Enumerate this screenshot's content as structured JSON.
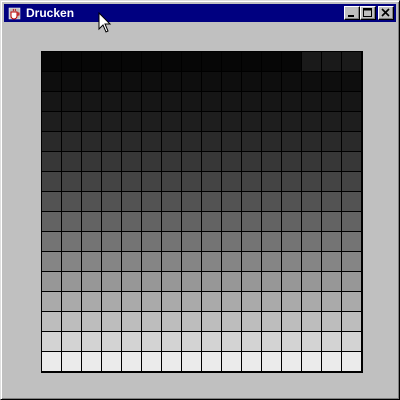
{
  "window": {
    "title": "Drucken",
    "icon": "java-cup-icon",
    "buttons": [
      {
        "name": "minimize-button",
        "icon": "minimize-icon"
      },
      {
        "name": "maximize-button",
        "icon": "maximize-icon"
      },
      {
        "name": "close-button",
        "icon": "close-icon"
      }
    ]
  },
  "colors": {
    "titlebar": "#000080",
    "face": "#c0c0c0",
    "grid_lines": "#000000"
  },
  "swatch_grid": {
    "rows": 16,
    "cols": 16,
    "shades": [
      "#060606",
      "#0e0e0e",
      "#161616",
      "#1e1e1e",
      "#2a2a2a",
      "#373737",
      "#444444",
      "#535353",
      "#636363",
      "#747474",
      "#858585",
      "#979797",
      "#aaaaaa",
      "#bdbdbd",
      "#d3d3d3",
      "#ebebeb"
    ],
    "first_row_split": 13,
    "first_row_tail": "#1a1a1a"
  }
}
